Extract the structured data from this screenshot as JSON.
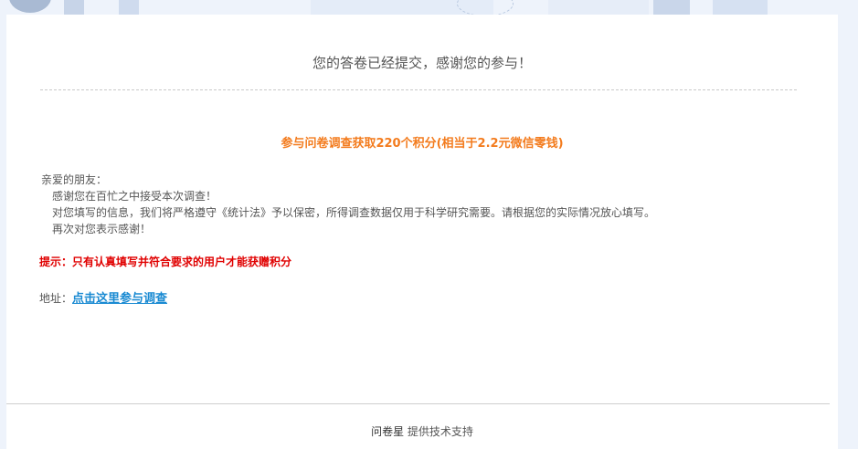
{
  "page": {
    "title": "您的答卷已经提交，感谢您的参与！",
    "reward": "参与问卷调查获取220个积分(相当于2.2元微信零钱)",
    "greeting": "亲爱的朋友：",
    "lines": [
      "感谢您在百忙之中接受本次调查！",
      "对您填写的信息，我们将严格遵守《统计法》予以保密，所得调查数据仅用于科学研究需要。请根据您的实际情况放心填写。",
      "再次对您表示感谢！"
    ],
    "hint": "提示：只有认真填写并符合要求的用户才能获赠积分",
    "address_label": "地址：",
    "address_link": "点击这里参与调查"
  },
  "footer": {
    "brand": "问卷星",
    "text": "提供技术支持"
  },
  "colors": {
    "reward": "#f37b1d",
    "hint": "#e00000",
    "link": "#1a8ad2"
  }
}
